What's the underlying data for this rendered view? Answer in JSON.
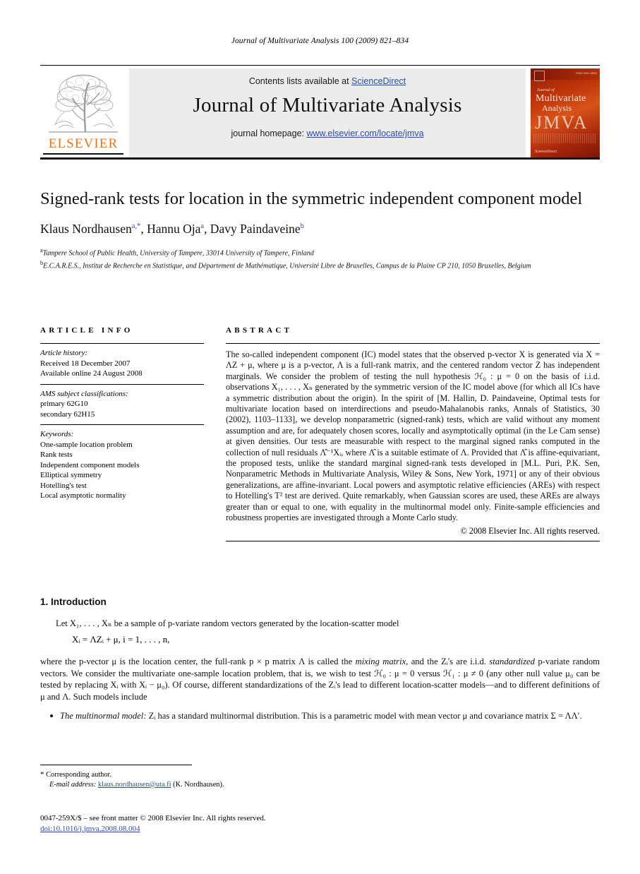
{
  "running_head": "Journal of Multivariate Analysis 100 (2009) 821–834",
  "masthead": {
    "contents_prefix": "Contents lists available at ",
    "sciencedirect": "ScienceDirect",
    "journal_title": "Journal of Multivariate Analysis",
    "homepage_prefix": "journal homepage: ",
    "homepage_url": "www.elsevier.com/locate/jmva",
    "publisher_wordmark": "ELSEVIER",
    "link_color": "#2b4f9e",
    "wordmark_color": "#E87722",
    "panel_bg": "#ececec"
  },
  "cover": {
    "issn_line": "ISSN 0047-259X",
    "journal_of": "Journal of",
    "multivariate": "Multivariate",
    "analysis": "Analysis",
    "acronym": "JMVA",
    "sciencedirect": "ScienceDirect"
  },
  "title": "Signed-rank tests for location in the symmetric independent component model",
  "authors": [
    {
      "name": "Klaus Nordhausen",
      "marker": "a,*"
    },
    {
      "name": "Hannu Oja",
      "marker": "a"
    },
    {
      "name": "Davy Paindaveine",
      "marker": "b"
    }
  ],
  "affiliations": [
    {
      "marker": "a",
      "text": "Tampere School of Public Health, University of Tampere, 33014 University of Tampere, Finland"
    },
    {
      "marker": "b",
      "text": "E.C.A.R.E.S., Institut de Recherche en Statistique, and Département de Mathématique, Université Libre de Bruxelles, Campus de la Plaine CP 210, 1050 Bruxelles, Belgium"
    }
  ],
  "columns": {
    "info_heading": "ARTICLE INFO",
    "abstract_heading": "ABSTRACT"
  },
  "article_info": {
    "history_label": "Article history:",
    "history_lines": [
      "Received 18 December 2007",
      "Available online 24 August 2008"
    ],
    "ams_label": "AMS subject classifications:",
    "ams_lines": [
      "primary 62G10",
      "secondary 62H15"
    ],
    "keywords_label": "Keywords:",
    "keywords": [
      "One-sample location problem",
      "Rank tests",
      "Independent component models",
      "Elliptical symmetry",
      "Hotelling's test",
      "Local asymptotic normality"
    ]
  },
  "abstract": {
    "paragraph": "The so-called independent component (IC) model states that the observed p-vector X is generated via X = ΛZ + μ, where μ is a p-vector, Λ is a full-rank matrix, and the centered random vector Z has independent marginals. We consider the problem of testing the null hypothesis ℋ₀ : μ = 0 on the basis of i.i.d. observations X₁, . . . , Xₙ generated by the symmetric version of the IC model above (for which all ICs have a symmetric distribution about the origin). In the spirit of [M. Hallin, D. Paindaveine, Optimal tests for multivariate location based on interdirections and pseudo-Mahalanobis ranks, Annals of Statistics, 30 (2002), 1103–1133], we develop nonparametric (signed-rank) tests, which are valid without any moment assumption and are, for adequately chosen scores, locally and asymptotically optimal (in the Le Cam sense) at given densities. Our tests are measurable with respect to the marginal signed ranks computed in the collection of null residuals Λ̂⁻¹Xᵢ, where Λ̂ is a suitable estimate of Λ. Provided that Λ̂ is affine-equivariant, the proposed tests, unlike the standard marginal signed-rank tests developed in [M.L. Puri, P.K. Sen, Nonparametric Methods in Multivariate Analysis, Wiley & Sons, New York, 1971] or any of their obvious generalizations, are affine-invariant. Local powers and asymptotic relative efficiencies (AREs) with respect to Hotelling's T² test are derived. Quite remarkably, when Gaussian scores are used, these AREs are always greater than or equal to one, with equality in the multinormal model only. Finite-sample efficiencies and robustness properties are investigated through a Monte Carlo study.",
    "copyright": "© 2008 Elsevier Inc. All rights reserved."
  },
  "body": {
    "section_number_title": "1. Introduction",
    "paragraph_1": "Let X₁, . . . , Xₙ be a sample of p-variate random vectors generated by the location-scatter model",
    "equation": "Xᵢ = ΛZᵢ + μ,    i = 1, . . . , n,",
    "paragraph_2_pre": "where the p-vector μ is the location center, the full-rank p × p matrix Λ is called the ",
    "paragraph_2_em1": "mixing matrix",
    "paragraph_2_mid": ", and the Zᵢ's are i.i.d. ",
    "paragraph_2_em2": "standardized",
    "paragraph_2_post": " p-variate random vectors. We consider the multivariate one-sample location problem, that is, we wish to test ℋ₀ : μ = 0 versus ℋ₁ : μ ≠ 0 (any other null value μ₀ can be tested by replacing Xᵢ with Xᵢ − μ₀). Of course, different standardizations of the Zᵢ's lead to different location-scatter models—and to different definitions of μ and Λ. Such models include",
    "bullets": [
      {
        "em": "The multinormal model:",
        "text": " Zᵢ has a standard multinormal distribution. This is a parametric model with mean vector μ and covariance matrix Σ = ΛΛ′."
      }
    ]
  },
  "footnote": {
    "star": "*",
    "corresponding": "Corresponding author.",
    "email_label": "E-mail address:",
    "email": "klaus.nordhausen@uta.fi",
    "email_suffix": "(K. Nordhausen)."
  },
  "footer": {
    "front_matter": "0047-259X/$ – see front matter © 2008 Elsevier Inc. All rights reserved.",
    "doi": "doi:10.1016/j.jmva.2008.08.004"
  }
}
